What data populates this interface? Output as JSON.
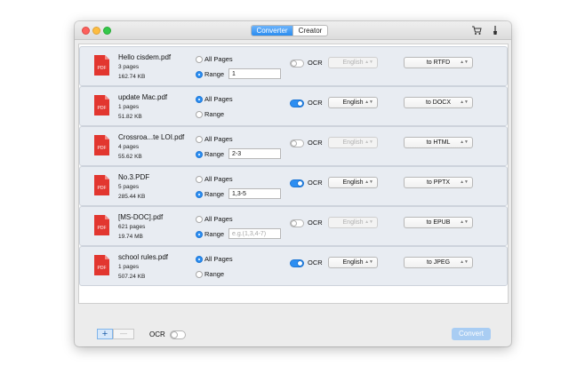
{
  "tabs": [
    {
      "label": "Converter",
      "active": true
    },
    {
      "label": "Creator",
      "active": false
    }
  ],
  "toolbar_icons": [
    "cart-icon",
    "brush-icon"
  ],
  "files": [
    {
      "icon_label": "PDF",
      "name": "Hello cisdem.pdf",
      "pages": "3 pages",
      "size": "162.74 KB",
      "all_pages_label": "All Pages",
      "range_label": "Range",
      "mode": "range",
      "range_value": "1",
      "range_placeholder": "",
      "ocr_label": "OCR",
      "ocr_on": false,
      "language": "English",
      "language_enabled": false,
      "format": "to RTFD"
    },
    {
      "icon_label": "PDF",
      "name": "update Mac.pdf",
      "pages": "1 pages",
      "size": "51.82 KB",
      "all_pages_label": "All Pages",
      "range_label": "Range",
      "mode": "all",
      "range_value": "",
      "range_placeholder": "",
      "ocr_label": "OCR",
      "ocr_on": true,
      "language": "English",
      "language_enabled": true,
      "format": "to DOCX"
    },
    {
      "icon_label": "PDF",
      "name": "Crossroa...te LOI.pdf",
      "pages": "4 pages",
      "size": "55.62 KB",
      "all_pages_label": "All Pages",
      "range_label": "Range",
      "mode": "range",
      "range_value": "2-3",
      "range_placeholder": "",
      "ocr_label": "OCR",
      "ocr_on": false,
      "language": "English",
      "language_enabled": false,
      "format": "to HTML"
    },
    {
      "icon_label": "PDF",
      "name": "No.3.PDF",
      "pages": "5 pages",
      "size": "285.44 KB",
      "all_pages_label": "All Pages",
      "range_label": "Range",
      "mode": "range",
      "range_value": "1,3-5",
      "range_placeholder": "",
      "ocr_label": "OCR",
      "ocr_on": true,
      "language": "English",
      "language_enabled": true,
      "format": "to PPTX"
    },
    {
      "icon_label": "PDF",
      "name": "[MS-DOC].pdf",
      "pages": "621 pages",
      "size": "19.74 MB",
      "all_pages_label": "All Pages",
      "range_label": "Range",
      "mode": "range",
      "range_value": "",
      "range_placeholder": "e.g.(1,3,4-7)",
      "ocr_label": "OCR",
      "ocr_on": false,
      "language": "English",
      "language_enabled": false,
      "format": "to EPUB"
    },
    {
      "icon_label": "PDF",
      "name": "school rules.pdf",
      "pages": "1 pages",
      "size": "507.24 KB",
      "all_pages_label": "All Pages",
      "range_label": "Range",
      "mode": "all",
      "range_value": "",
      "range_placeholder": "",
      "ocr_label": "OCR",
      "ocr_on": true,
      "language": "English",
      "language_enabled": true,
      "format": "to JPEG"
    }
  ],
  "bottom": {
    "add_label": "+",
    "remove_label": "—",
    "ocr_label": "OCR",
    "ocr_on": false,
    "convert_label": "Convert"
  },
  "colors": {
    "accent": "#2c8ef2",
    "pdf_icon": "#e2362f",
    "row_background": "#e8ecf2",
    "convert_disabled": "#a9cdf3"
  }
}
